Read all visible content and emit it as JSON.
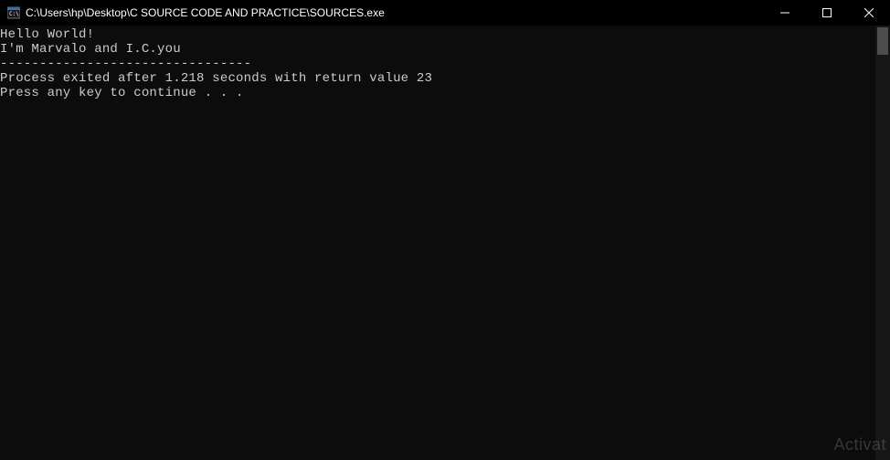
{
  "titlebar": {
    "title": "C:\\Users\\hp\\Desktop\\C SOURCE CODE AND PRACTICE\\SOURCES.exe"
  },
  "console": {
    "lines": [
      "Hello World!",
      "I'm Marvalo and I.C.you",
      "--------------------------------",
      "Process exited after 1.218 seconds with return value 23",
      "Press any key to continue . . ."
    ]
  },
  "watermark": {
    "text": "Activat"
  }
}
